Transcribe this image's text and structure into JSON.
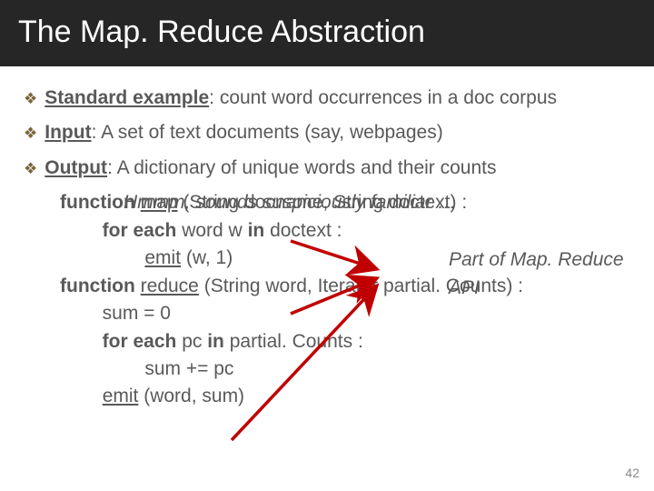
{
  "title": "The Map. Reduce Abstraction",
  "bullets": {
    "b1": {
      "label": "Standard example",
      "text": ": count word occurrences in a doc corpus"
    },
    "b2": {
      "label": "Input",
      "text": ": A set of text documents (say, webpages)"
    },
    "b3": {
      "label": "Output",
      "text": ": A dictionary of unique words and their counts"
    }
  },
  "code": {
    "l1a": "function ",
    "l1b": "map",
    "l1c": " (String docname, String doctext) :",
    "l2a": "        for each ",
    "l2b": "word w ",
    "l2c": "in",
    "l2d": " doctext :",
    "l3a": "                ",
    "l3b": "emit",
    "l3c": " (w, 1)",
    "l4a": "function ",
    "l4b": "reduce",
    "l4c": " (String word, Iterator partial. Counts) :",
    "l5": "        sum = 0",
    "l6a": "        for each ",
    "l6b": "pc ",
    "l6c": "in",
    "l6d": " partial. Counts :",
    "l7": "                sum += pc",
    "l8a": "        ",
    "l8b": "emit",
    "l8c": " (word, sum)"
  },
  "overlays": {
    "hmm": "Hmmm, sounds suspiciously familiar …",
    "api": "Part of Map. Reduce API"
  },
  "page": "42"
}
